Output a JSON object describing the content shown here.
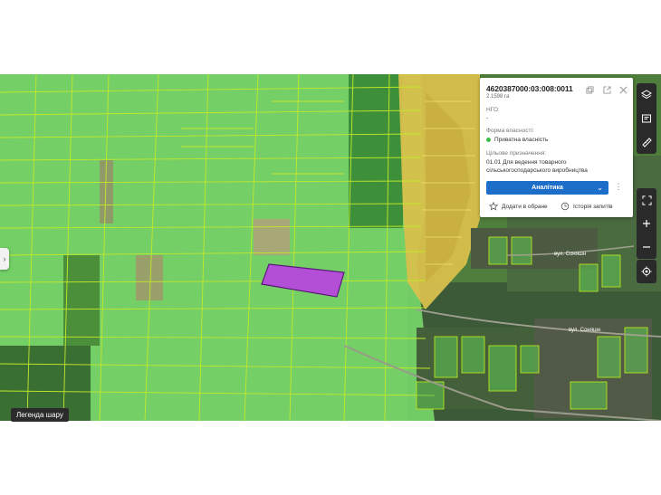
{
  "parcel": {
    "cadastral_number": "4620387000:03:008:0011",
    "area": "2.1598 га",
    "ngo_label": "НГО:",
    "ngo_value": "-",
    "ownership_label": "Форма власності:",
    "ownership_value": "Приватна власність",
    "purpose_label": "Цільове призначення:",
    "purpose_value": "01.01 Для ведення товарного сільськогосподарського виробництва",
    "analytics_button": "Аналітика",
    "favorite_button": "Додати в обране",
    "history_button": "Історія запитів"
  },
  "map": {
    "legend_button": "Легенда шару",
    "street_label_1": "вул. Соняшн",
    "street_label_2": "вул. Соняшн"
  },
  "icons": {
    "copy": "copy-icon",
    "open": "open-external-icon",
    "close": "close-icon",
    "star": "star-icon",
    "history": "history-icon",
    "layers": "layers-icon",
    "identify": "identify-icon",
    "ruler": "ruler-icon",
    "fullscreen": "fullscreen-icon",
    "zoom_in": "zoom-in-icon",
    "zoom_out": "zoom-out-icon",
    "locate": "locate-icon",
    "expand_panel": "chevron-right-icon"
  },
  "colors": {
    "parcel_fill_green": "#7fe07a",
    "parcel_outline": "#b5e61d",
    "selected_parcel": "#b34fd6",
    "state_land_yellow": "#e2c84a",
    "accent_blue": "#1d6ec9",
    "status_green": "#3cbf4a"
  }
}
